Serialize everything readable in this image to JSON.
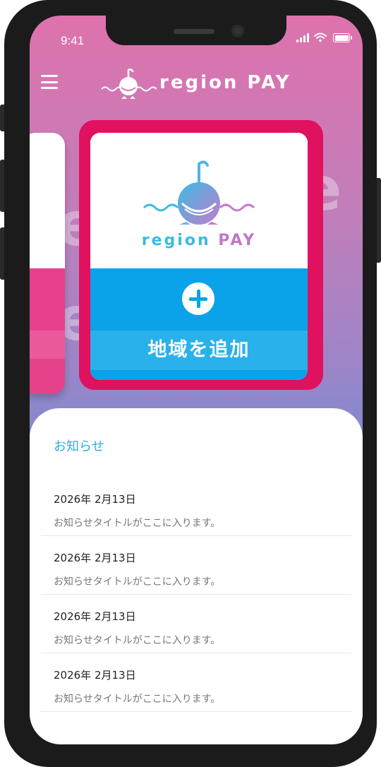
{
  "status_bar": {
    "time": "9:41"
  },
  "header": {
    "brand": "region PAY"
  },
  "card": {
    "brand_part1": "region ",
    "brand_part2": "PAY",
    "add_label": "地域を追加"
  },
  "notices": {
    "title": "お知らせ",
    "items": [
      {
        "date": "2026年 2月13日",
        "title": "お知らせタイトルがここに入ります。"
      },
      {
        "date": "2026年 2月13日",
        "title": "お知らせタイトルがここに入ります。"
      },
      {
        "date": "2026年 2月13日",
        "title": "お知らせタイトルがここに入ります。"
      },
      {
        "date": "2026年 2月13日",
        "title": "お知らせタイトルがここに入ります。"
      }
    ]
  },
  "colors": {
    "accent_pink": "#e0115f",
    "accent_blue": "#0aa2e8",
    "notice_title": "#2ab0e4"
  }
}
